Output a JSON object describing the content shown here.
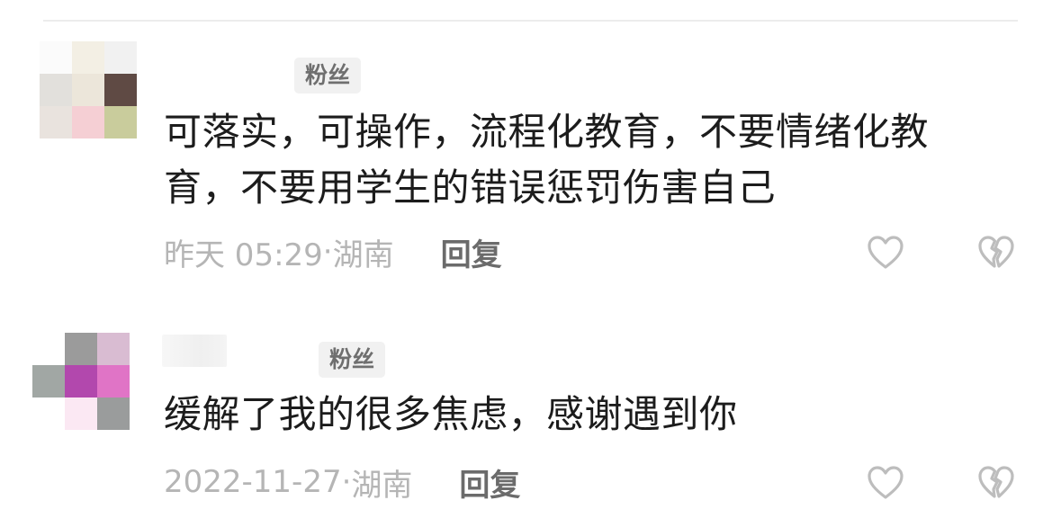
{
  "comments": [
    {
      "badge": "粉丝",
      "text": "可落实，可操作，流程化教育，不要情绪化教育，不要用学生的错误惩罚伤害自己",
      "time": "昨天 05:29",
      "separator": "·",
      "location": "湖南",
      "reply_label": "回复",
      "like_icon": "heart-outline-icon",
      "dislike_icon": "broken-heart-outline-icon"
    },
    {
      "badge": "粉丝",
      "text": "缓解了我的很多焦虑，感谢遇到你",
      "time": "2022-11-27",
      "separator": "·",
      "location": "湖南",
      "reply_label": "回复",
      "like_icon": "heart-outline-icon",
      "dislike_icon": "broken-heart-outline-icon"
    }
  ],
  "colors": {
    "text": "#1c1c1c",
    "meta": "#b5b5b5",
    "reply": "#6b6b6b",
    "badge_bg": "#f1f1f1",
    "badge_text": "#6f6f6f",
    "icon": "#bdbdbd"
  }
}
